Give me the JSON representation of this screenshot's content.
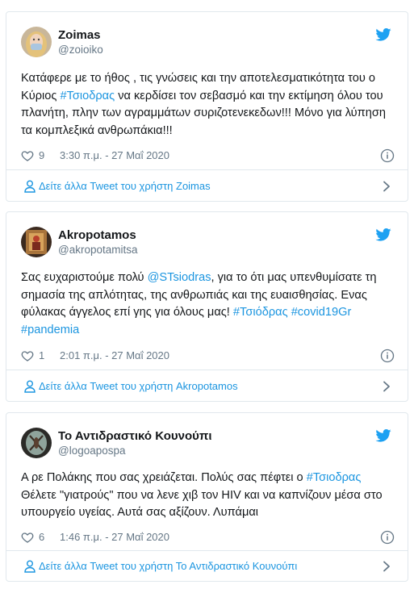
{
  "tweets": [
    {
      "display_name": "Zoimas",
      "handle": "@zoioiko",
      "text_segments": [
        {
          "t": "Κατάφερε με το ήθος , τις γνώσεις και την αποτελεσματικότητα του ο Κύριος ",
          "hl": false
        },
        {
          "t": "#Τσιοδρας",
          "hl": true
        },
        {
          "t": " να κερδίσει τον σεβασμό και την εκτίμηση όλου του πλανήτη, πλην των αγραμμάτων συριζοτενεκεδων!!! Μόνο για λύπηση τα κομπλεξικά  ανθρωπάκια!!!",
          "hl": false
        }
      ],
      "likes": "9",
      "time": "3:30 π.μ. - 27 Μαΐ 2020",
      "more_label": "Δείτε άλλα Tweet του χρήστη Zoimas",
      "avatar_icon": "woman-with-mask-avatar"
    },
    {
      "display_name": "Akropotamos",
      "handle": "@akropotamitsa",
      "text_segments": [
        {
          "t": "Σας ευχαριστούμε πολύ ",
          "hl": false
        },
        {
          "t": "@STsiodras",
          "hl": true
        },
        {
          "t": ", για το ότι μας υπενθυμίσατε τη σημασία της απλότητας, της ανθρωπιάς και της ευαισθησίας. Ενας φύλακας άγγελος επί γης για όλους μας!  ",
          "hl": false
        },
        {
          "t": "#Τσιόδρας",
          "hl": true
        },
        {
          "t": " ",
          "hl": false
        },
        {
          "t": "#covid19Gr",
          "hl": true
        },
        {
          "t": " ",
          "hl": false
        },
        {
          "t": "#pandemia",
          "hl": true
        }
      ],
      "likes": "1",
      "time": "2:01 π.μ. - 27 Μαΐ 2020",
      "more_label": "Δείτε άλλα Tweet του χρήστη Akropotamos",
      "avatar_icon": "icon-painting-avatar"
    },
    {
      "display_name": "Το Αντιδραστικό Κουνούπι",
      "handle": "@logoapospa",
      "text_segments": [
        {
          "t": "Α ρε Πολάκης που σας χρειάζεται. Πολύς σας πέφτει ο ",
          "hl": false
        },
        {
          "t": "#Τσιοδρας",
          "hl": true
        },
        {
          "t": " Θέλετε \"γιατρούς\" που να λενε χιβ τον HIV και να καπνίζουν μέσα στο υπουργείο υγείας. Αυτά σας αξίζουν. Λυπάμαι",
          "hl": false
        }
      ],
      "likes": "6",
      "time": "1:46 π.μ. - 27 Μαΐ 2020",
      "more_label": "Δείτε άλλα Tweet του χρήστη Το Αντιδραστικό Κουνούπι",
      "avatar_icon": "mosquito-avatar"
    }
  ],
  "colors": {
    "link": "#1b95e0",
    "text": "#14171a",
    "muted": "#657786",
    "border": "#e1e8ed",
    "twitter_blue": "#1da1f2"
  },
  "icons": {
    "brand": "twitter-bird-icon",
    "like": "heart-icon",
    "info": "info-icon",
    "profile": "person-icon",
    "more": "chevron-right-icon"
  }
}
